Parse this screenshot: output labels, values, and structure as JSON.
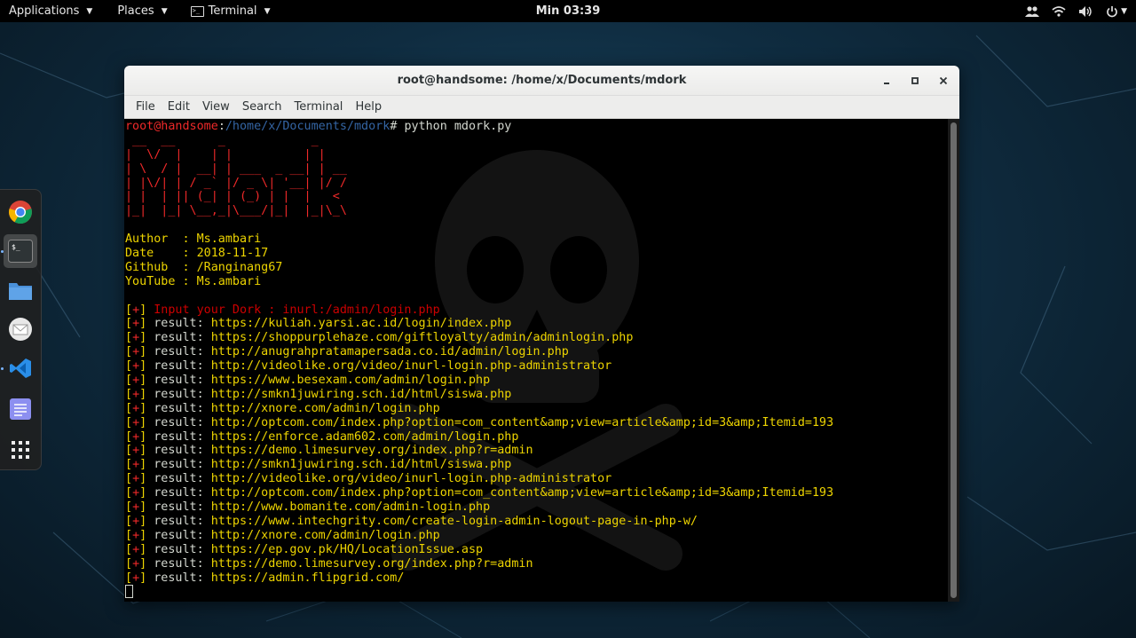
{
  "topbar": {
    "applications": "Applications",
    "places": "Places",
    "terminal": "Terminal",
    "clock": "Min 03:39"
  },
  "dock": {
    "items": [
      "chrome-icon",
      "terminal-icon",
      "files-icon",
      "mail-icon",
      "vscode-icon",
      "text-editor-icon",
      "app-grid-icon"
    ]
  },
  "window": {
    "title": "root@handsome: /home/x/Documents/mdork",
    "menu": [
      "File",
      "Edit",
      "View",
      "Search",
      "Terminal",
      "Help"
    ]
  },
  "terminal": {
    "prompt_user": "root@handsome",
    "prompt_sep": ":",
    "prompt_path": "/home/x/Documents/mdork",
    "prompt_hash": "# ",
    "command": "python mdork.py",
    "logo": [
      " __  __      _            _    ",
      "|  \\/  |    | |          | |   ",
      "| \\  / |  __| | ___  _ __| | __",
      "| |\\/| | / _` |/ _ \\| '__| |/ /",
      "| |  | || (_| | (_) | |  |   < ",
      "|_|  |_| \\__,_|\\___/|_|  |_|\\_\\"
    ],
    "info": [
      {
        "label": "Author  : ",
        "value": "Ms.ambari"
      },
      {
        "label": "Date    : ",
        "value": "2018-11-17"
      },
      {
        "label": "Github  : ",
        "value": "/Ranginang67"
      },
      {
        "label": "YouTube : ",
        "value": "Ms.ambari"
      }
    ],
    "input_line": "Input your Dork : inurl:/admin/login.php",
    "bracket": "[+]",
    "result_label": " result: ",
    "results": [
      "https://kuliah.yarsi.ac.id/login/index.php",
      "https://shoppurplehaze.com/giftloyalty/admin/adminlogin.php",
      "http://anugrahpratamapersada.co.id/admin/login.php",
      "http://videolike.org/video/inurl-login.php-administrator",
      "https://www.besexam.com/admin/login.php",
      "http://smkn1juwiring.sch.id/html/siswa.php",
      "http://xnore.com/admin/login.php",
      "http://optcom.com/index.php?option=com_content&amp;view=article&amp;id=3&amp;Itemid=193",
      "https://enforce.adam602.com/admin/login.php",
      "https://demo.limesurvey.org/index.php?r=admin",
      "http://smkn1juwiring.sch.id/html/siswa.php",
      "http://videolike.org/video/inurl-login.php-administrator",
      "http://optcom.com/index.php?option=com_content&amp;view=article&amp;id=3&amp;Itemid=193",
      "http://www.bomanite.com/admin-login.php",
      "https://www.intechgrity.com/create-login-admin-logout-page-in-php-w/",
      "http://xnore.com/admin/login.php",
      "https://ep.gov.pk/HQ/LocationIssue.asp",
      "https://demo.limesurvey.org/index.php?r=admin",
      "https://admin.flipgrid.com/"
    ]
  }
}
